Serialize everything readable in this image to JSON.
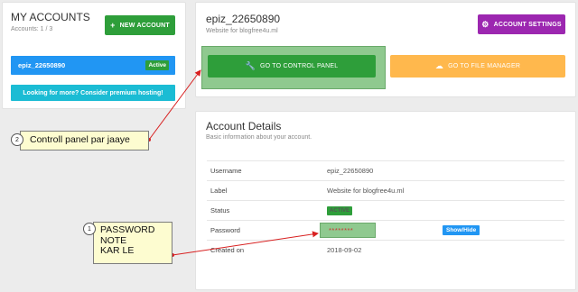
{
  "accounts_panel": {
    "title": "MY ACCOUNTS",
    "count": "Accounts: 1 / 3",
    "new_account_label": "NEW ACCOUNT",
    "account_name": "epiz_22650890",
    "account_status": "Active",
    "premium_label": "Looking for more? Consider premium hosting!"
  },
  "account_header": {
    "username": "epiz_22650890",
    "subtitle": "Website for blogfree4u.ml",
    "settings_label": "ACCOUNT SETTINGS",
    "control_panel_label": "GO TO CONTROL PANEL",
    "file_manager_label": "GO TO FILE MANAGER"
  },
  "details": {
    "title": "Account Details",
    "subtitle": "Basic information about your account.",
    "rows": [
      {
        "key": "Username",
        "value": "epiz_22650890"
      },
      {
        "key": "Label",
        "value": "Website for blogfree4u.ml"
      },
      {
        "key": "Status",
        "value": "ACTIVE"
      },
      {
        "key": "Password",
        "value": "********"
      },
      {
        "key": "Created on",
        "value": "2018-09-02"
      }
    ],
    "show_hide_label": "Show/Hide"
  },
  "annotations": {
    "note1_number": "1",
    "note1_lines": [
      "PASSWORD",
      "NOTE",
      "KAR LE"
    ],
    "note2_number": "2",
    "note2_text": "Controll panel par jaaye"
  },
  "colors": {
    "green": "#2e9e3a",
    "blue": "#2196f3",
    "cyan": "#1bbcd4",
    "purple": "#9c27b0",
    "orange": "#ffb84d",
    "highlight": "#8fc98f",
    "arrow": "#d82020"
  },
  "icons": {
    "new_account": "plus-icon",
    "settings": "gear-icon",
    "control_panel": "wrench-icon",
    "file_manager": "cloud-upload-icon"
  }
}
